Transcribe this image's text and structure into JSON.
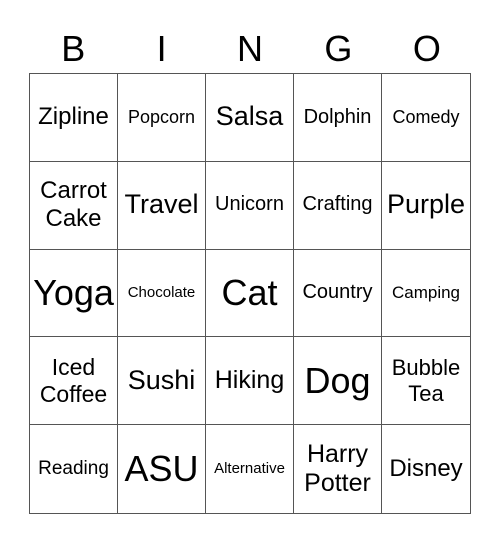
{
  "header": [
    "B",
    "I",
    "N",
    "G",
    "O"
  ],
  "cells": [
    {
      "text": "Zipline",
      "size": "l"
    },
    {
      "text": "Popcorn",
      "size": "s"
    },
    {
      "text": "Salsa",
      "size": "xl"
    },
    {
      "text": "Dolphin",
      "size": "m"
    },
    {
      "text": "Comedy",
      "size": "s"
    },
    {
      "text": "Carrot Cake",
      "size": "l"
    },
    {
      "text": "Travel",
      "size": "xl"
    },
    {
      "text": "Unicorn",
      "size": "m"
    },
    {
      "text": "Crafting",
      "size": "m"
    },
    {
      "text": "Purple",
      "size": "xl"
    },
    {
      "text": "Yoga",
      "size": "xxl"
    },
    {
      "text": "Chocolate",
      "size": "xs"
    },
    {
      "text": "Cat",
      "size": "xxl"
    },
    {
      "text": "Country",
      "size": "m"
    },
    {
      "text": "Camping",
      "size": "xs2"
    },
    {
      "text": "Iced Coffee",
      "size": "l2"
    },
    {
      "text": "Sushi",
      "size": "xl"
    },
    {
      "text": "Hiking",
      "size": "l3"
    },
    {
      "text": "Dog",
      "size": "xxl"
    },
    {
      "text": "Bubble Tea",
      "size": "ml"
    },
    {
      "text": "Reading",
      "size": "s2"
    },
    {
      "text": "ASU",
      "size": "xxl"
    },
    {
      "text": "Alternative",
      "size": "xs"
    },
    {
      "text": "Harry Potter",
      "size": "l3"
    },
    {
      "text": "Disney",
      "size": "l"
    }
  ]
}
